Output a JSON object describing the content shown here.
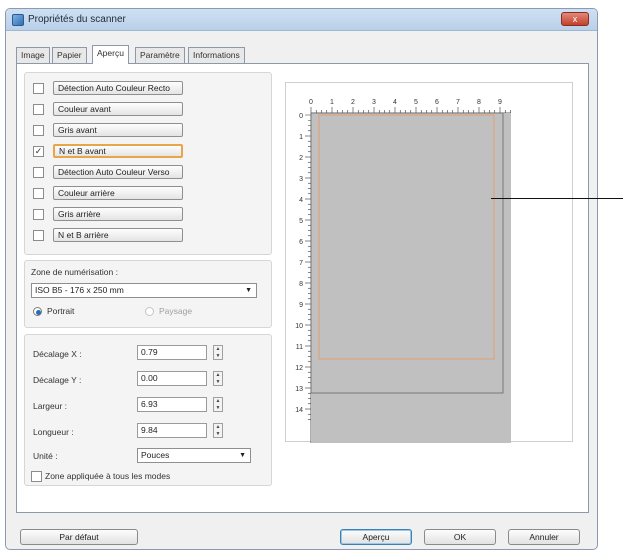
{
  "window": {
    "title": "Propriétés du scanner",
    "close_label": "x"
  },
  "tabs": [
    "Image",
    "Papier",
    "Aperçu",
    "Paramètre",
    "Informations"
  ],
  "active_tab": 2,
  "modes": [
    {
      "label": "Détection Auto Couleur Recto",
      "checked": false,
      "selected": false
    },
    {
      "label": "Couleur avant",
      "checked": false,
      "selected": false
    },
    {
      "label": "Gris avant",
      "checked": false,
      "selected": false
    },
    {
      "label": "N et B avant",
      "checked": true,
      "selected": true
    },
    {
      "label": "Détection Auto Couleur Verso",
      "checked": false,
      "selected": false
    },
    {
      "label": "Couleur arrière",
      "checked": false,
      "selected": false
    },
    {
      "label": "Gris arrière",
      "checked": false,
      "selected": false
    },
    {
      "label": "N et B arrière",
      "checked": false,
      "selected": false
    }
  ],
  "scan_area": {
    "label": "Zone de numérisation :",
    "value": "ISO B5 - 176 x 250 mm",
    "portrait_label": "Portrait",
    "landscape_label": "Paysage",
    "orientation": "portrait"
  },
  "fields": [
    {
      "label": "Décalage X :",
      "value": "0.79"
    },
    {
      "label": "Décalage Y :",
      "value": "0.00"
    },
    {
      "label": "Largeur :",
      "value": "6.93"
    },
    {
      "label": "Longueur :",
      "value": "9.84"
    }
  ],
  "unit": {
    "label": "Unité :",
    "value": "Pouces"
  },
  "apply_all": {
    "label": "Zone appliquée à tous les modes",
    "checked": false
  },
  "ruler": {
    "h_labels": [
      "0",
      "1",
      "2",
      "3",
      "4",
      "5",
      "6",
      "7",
      "8",
      "9"
    ],
    "v_labels": [
      "0",
      "1",
      "2",
      "3",
      "4",
      "5",
      "6",
      "7",
      "8",
      "9",
      "10",
      "11",
      "12",
      "13",
      "14"
    ]
  },
  "buttons": {
    "default": "Par défaut",
    "preview": "Aperçu",
    "ok": "OK",
    "cancel": "Annuler"
  },
  "colors": {
    "preview_gray": "#c0c0c0",
    "scan_frame": "#e0a070",
    "accent": "#e8a64b"
  }
}
